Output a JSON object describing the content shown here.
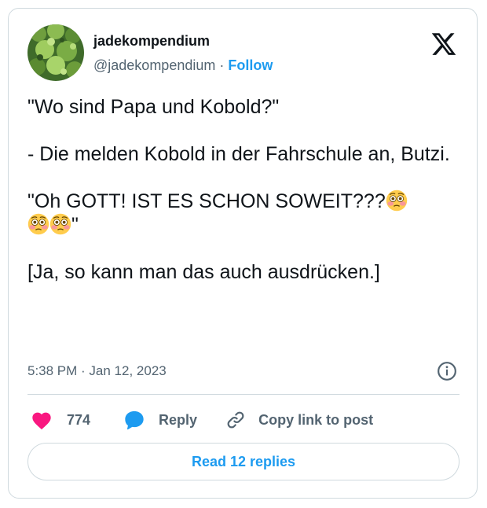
{
  "author": {
    "display_name": "jadekompendium",
    "handle": "@jadekompendium",
    "separator": " · ",
    "follow_label": "Follow",
    "avatar_icon": "plant-avatar"
  },
  "platform_icon": "x-logo",
  "tweet": {
    "line1": "\"Wo sind Papa und Kobold?\"",
    "line2": "- Die melden Kobold in der Fahrschule an, Butzi.",
    "line3_text": "\"Oh GOTT! IST ES SCHON SOWEIT???",
    "line3_end": "\"",
    "line3_emoji": "flushed-face",
    "line4": "[Ja, so kann man das auch ausdrücken.]"
  },
  "timestamp": {
    "time": "5:38 PM",
    "separator": " · ",
    "date": "Jan 12, 2023"
  },
  "actions": {
    "like_count": "774",
    "reply_label": "Reply",
    "copy_label": "Copy link to post"
  },
  "read_replies_label": "Read 12 replies",
  "colors": {
    "accent": "#1d9bf0",
    "like": "#f91880",
    "muted": "#536471",
    "border": "#cfd9de"
  }
}
